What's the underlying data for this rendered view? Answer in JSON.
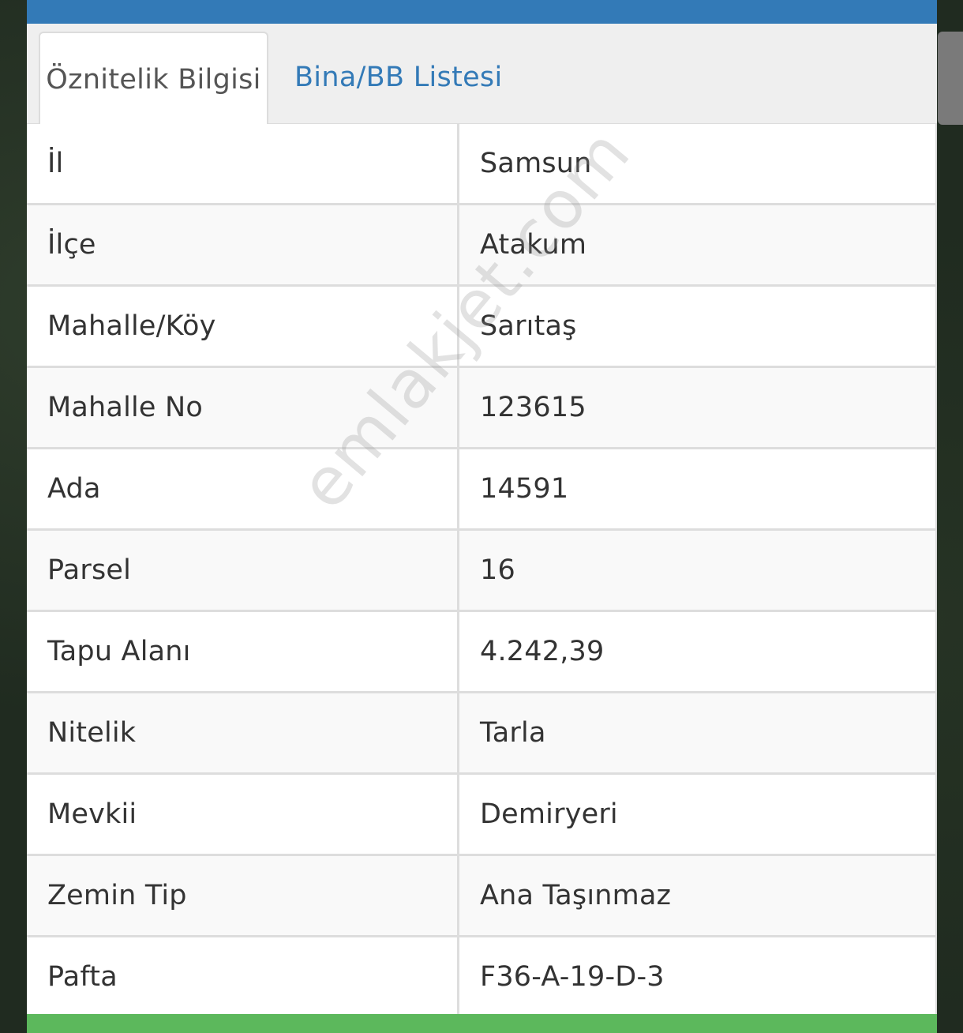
{
  "tabs": [
    {
      "label": "Öznitelik Bilgisi",
      "active": true
    },
    {
      "label": "Bina/BB Listesi",
      "active": false
    }
  ],
  "attributes": [
    {
      "key": "İl",
      "value": "Samsun"
    },
    {
      "key": "İlçe",
      "value": "Atakum"
    },
    {
      "key": "Mahalle/Köy",
      "value": "Sarıtaş"
    },
    {
      "key": "Mahalle No",
      "value": "123615"
    },
    {
      "key": "Ada",
      "value": "14591"
    },
    {
      "key": "Parsel",
      "value": "16"
    },
    {
      "key": "Tapu Alanı",
      "value": "4.242,39"
    },
    {
      "key": "Nitelik",
      "value": "Tarla"
    },
    {
      "key": "Mevkii",
      "value": "Demiryeri"
    },
    {
      "key": "Zemin Tip",
      "value": "Ana Taşınmaz"
    },
    {
      "key": "Pafta",
      "value": "F36-A-19-D-3"
    }
  ],
  "watermark": "emlakjet.com",
  "colors": {
    "header_bar": "#337ab7",
    "footer_bar": "#5cb85c",
    "tab_link": "#337ab7"
  }
}
